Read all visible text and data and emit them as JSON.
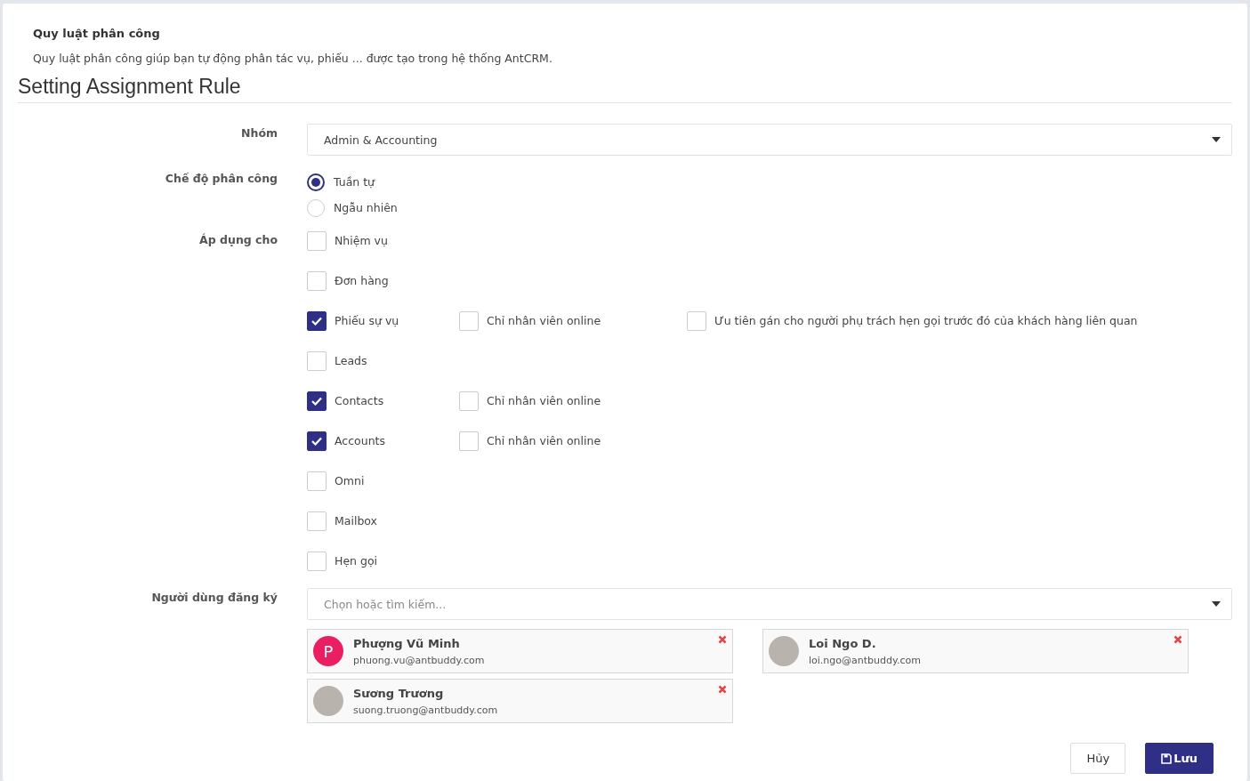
{
  "header": {
    "title": "Quy luật phân công",
    "description": "Quy luật phân công giúp bạn tự động phân tác vụ, phiếu ... được tạo trong hệ thống AntCRM."
  },
  "heading": "Setting Assignment Rule",
  "group": {
    "label": "Nhóm",
    "value": "Admin & Accounting"
  },
  "mode": {
    "label": "Chế độ phân công",
    "options": [
      {
        "label": "Tuần tự",
        "selected": true
      },
      {
        "label": "Ngẫu nhiên",
        "selected": false
      }
    ]
  },
  "apply": {
    "label": "Áp dụng cho",
    "items": [
      {
        "label": "Nhiệm vụ",
        "checked": false
      },
      {
        "label": "Đơn hàng",
        "checked": false
      },
      {
        "label": "Phiếu sự vụ",
        "checked": true,
        "options": [
          {
            "label": "Chỉ nhân viên online",
            "checked": false
          },
          {
            "label": "Ưu tiên gán cho người phụ trách hẹn gọi trước đó của khách hàng liên quan",
            "checked": false
          }
        ]
      },
      {
        "label": "Leads",
        "checked": false
      },
      {
        "label": "Contacts",
        "checked": true,
        "options": [
          {
            "label": "Chỉ nhân viên online",
            "checked": false
          }
        ]
      },
      {
        "label": "Accounts",
        "checked": true,
        "options": [
          {
            "label": "Chỉ nhân viên online",
            "checked": false
          }
        ]
      },
      {
        "label": "Omni",
        "checked": false
      },
      {
        "label": "Mailbox",
        "checked": false
      },
      {
        "label": "Hẹn gọi",
        "checked": false
      }
    ]
  },
  "users": {
    "label": "Người dùng đăng ký",
    "placeholder": "Chọn hoặc tìm kiếm...",
    "list": [
      {
        "name": "Phượng Vũ Minh",
        "email": "phuong.vu@antbuddy.com",
        "avatar": {
          "kind": "initial",
          "text": "P",
          "color": "#e91e63"
        }
      },
      {
        "name": "Loi Ngo D.",
        "email": "loi.ngo@antbuddy.com",
        "avatar": {
          "kind": "photo"
        }
      },
      {
        "name": "Sương Trương",
        "email": "suong.truong@antbuddy.com",
        "avatar": {
          "kind": "photo"
        }
      }
    ]
  },
  "buttons": [
    {
      "kind": "cancel",
      "label": "Hủy"
    },
    {
      "kind": "save",
      "label": "Lưu"
    }
  ]
}
